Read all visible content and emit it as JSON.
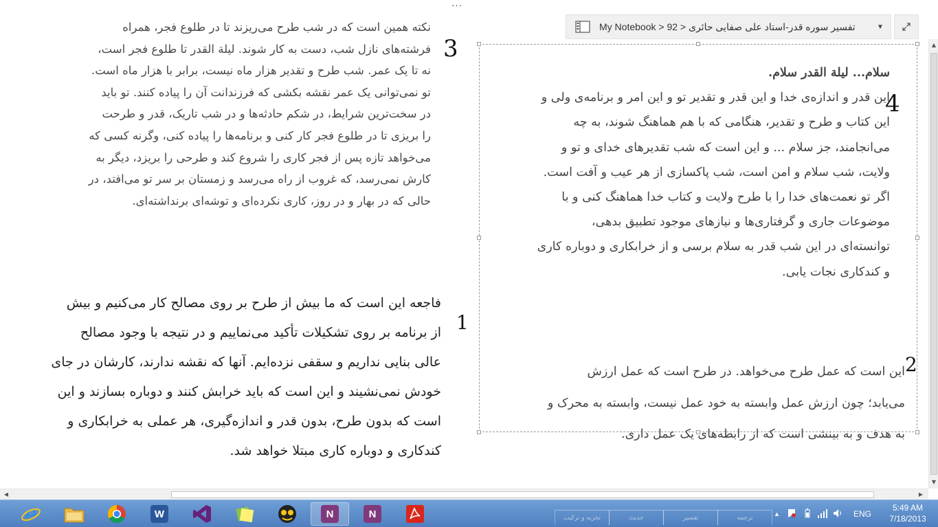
{
  "top_menu": {
    "ellipsis": "..."
  },
  "breadcrumb": {
    "text": "تفسیر سوره قدر-استاد علی صفایی حائری < 92 < My Notebook",
    "icon": "notebook-icon",
    "caret": "▼"
  },
  "expand_button": {
    "icon": "expand-icon",
    "glyph": "⤢"
  },
  "labels": {
    "n3": "3",
    "n1": "1",
    "n4": "4",
    "n2": "2"
  },
  "block3": {
    "lines": [
      "نکته همین است که در شب طرح می‌ریزند تا در طلوع فجر، همراه",
      "فرشته‌های نازل شب، دست به کار شوند. لیلة القدر تا طلوع فجر است،",
      "نه تا یک عمر. شب طرح و تقدیر هزار ماه نیست، برابر با هزار ماه است.",
      "تو نمی‌توانی یک عمر نقشه بکشی که فرزندانت آن را پیاده کنند. تو باید",
      "در سخت‌ترین شرایط، در شکم حادثه‌ها و در شب تاریک، قدر و طرحت",
      "را بریزی تا در طلوع فجر کار کنی و برنامه‌ها را پیاده کنی، وگرنه کسی که",
      "می‌خواهد تازه پس از فجر کاری را شروع کند و طرحی را بریزد، دیگر به",
      "کارش نمی‌رسد، که غروب از راه می‌رسد و زمستان بر سر تو می‌افتد، در",
      "حالی که در بهار و در روز، کاری نکرده‌ای و توشه‌ای برنداشته‌ای."
    ]
  },
  "block1": {
    "lines": [
      "فاجعه این است که ما بیش از طرح بر روی مصالح کار می‌کنیم و بیش",
      "از برنامه بر روی تشکیلات تأکید می‌نماییم و در نتیجه با وجود مصالح",
      "عالی بنایی نداریم و سقفی نزده‌ایم. آنها که نقشه ندارند، کارشان در جای",
      "خودش نمی‌نشیند و این است که باید خرابش کنند و دوباره بسازند و این",
      "است که بدون طرح، بدون قدر و اندازه‌گیری، هر عملی به خرابکاری و",
      "کندکاری و دوباره کاری مبتلا خواهد شد."
    ]
  },
  "block4": {
    "heading": "سلام... لیلة القدر سلام.",
    "lines": [
      "این قدر و اندازه‌ی خدا و این قدر و تقدیر تو و این امر و برنامه‌ی ولی و",
      "این کتاب و طرح و تقدیر، هنگامی که با هم هماهنگ شوند، به چه",
      "می‌انجامند، جز سلام ... و این است که شب تقدیرهای خدای و تو و",
      "ولایت، شب سلام و امن است، شب پاکسازی از هر عیب و آفت است.",
      "اگر تو نعمت‌های خدا را با طرح ولایت و کتاب خدا هماهنگ کنی و با",
      "موضوعات جاری و گرفتاری‌ها و نیازهای موجود تطبیق بدهی،",
      "توانسته‌ای در این شب قدر به سلام برسی و از خرابکاری و دوباره کاری",
      "و کندکاری نجات یابی."
    ]
  },
  "block2": {
    "lines": [
      "این است که عمل طرح می‌خواهد. در طرح است که عمل ارزش",
      "می‌یابد؛ چون ارزش عمل وابسته به خود عمل نیست، وابسته به محرک و",
      "به هدف و به بینشی است که از رابطه‌های یک عمل داری."
    ]
  },
  "taskbar": {
    "apps": [
      {
        "name": "internet-explorer",
        "icon": "ie-icon",
        "glyph": "e",
        "color": "#1e88e5"
      },
      {
        "name": "file-explorer",
        "icon": "folder-icon",
        "glyph": "",
        "color": "#e8b84a"
      },
      {
        "name": "chrome",
        "icon": "chrome-icon",
        "glyph": "",
        "color": "#dd4b39"
      },
      {
        "name": "word",
        "icon": "word-icon",
        "glyph": "W",
        "color": "#2b579a"
      },
      {
        "name": "visual-studio",
        "icon": "visual-studio-icon",
        "glyph": "",
        "color": "#68217a"
      },
      {
        "name": "sticky-app",
        "icon": "sticky-notes-icon",
        "glyph": "",
        "color": "#8bc34a"
      },
      {
        "name": "kmplayer",
        "icon": "media-player-icon",
        "glyph": "",
        "color": "#333333"
      },
      {
        "name": "onenote",
        "icon": "onenote-icon",
        "glyph": "N",
        "color": "#80397b"
      },
      {
        "name": "onenote-clipper",
        "icon": "onenote-clip-icon",
        "glyph": "N",
        "color": "#80397b"
      },
      {
        "name": "acrobat",
        "icon": "acrobat-icon",
        "glyph": "",
        "color": "#d9261c"
      }
    ],
    "faded_tabs": [
      "ترجمه",
      "تفسیر",
      "حدیث",
      "تجزیه و ترکیب"
    ],
    "language": "ENG",
    "time": "5:49 AM",
    "date": "7/18/2013"
  }
}
